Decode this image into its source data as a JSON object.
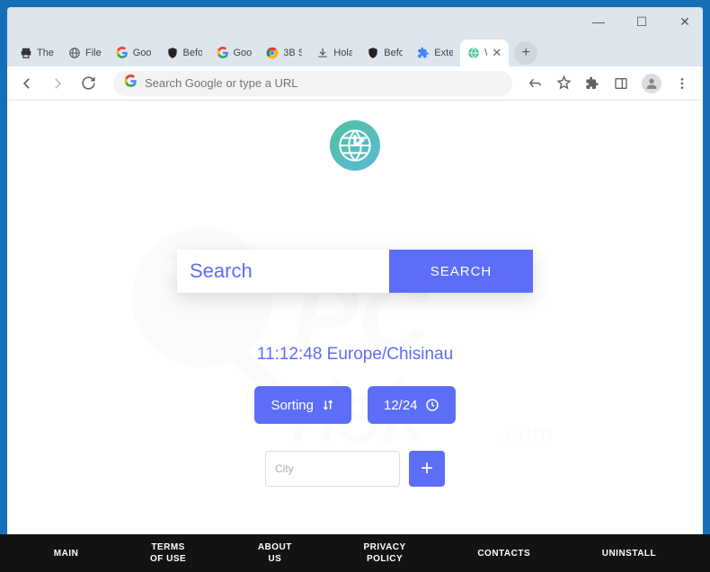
{
  "window": {
    "minimize": "—",
    "maximize": "☐",
    "close": "✕"
  },
  "tabs": [
    {
      "label": "The",
      "icon": "print"
    },
    {
      "label": "File",
      "icon": "globe-gray"
    },
    {
      "label": "Goo",
      "icon": "google"
    },
    {
      "label": "Befo",
      "icon": "shield"
    },
    {
      "label": "Goo",
      "icon": "google"
    },
    {
      "label": "3B S",
      "icon": "chrome"
    },
    {
      "label": "Hola",
      "icon": "download"
    },
    {
      "label": "Befo",
      "icon": "shield"
    },
    {
      "label": "Exte",
      "icon": "puzzle"
    },
    {
      "label": "\\",
      "icon": "globe-green",
      "active": true
    }
  ],
  "new_tab": "+",
  "omnibox": {
    "placeholder": "Search Google or type a URL"
  },
  "page": {
    "search_placeholder": "Search",
    "search_button": "SEARCH",
    "clock": "11:12:48 Europe/Chisinau",
    "sorting_label": "Sorting",
    "format_label": "12/24",
    "city_placeholder": "City",
    "add_label": "+"
  },
  "footer": {
    "main": "MAIN",
    "terms": "TERMS\nOF USE",
    "about": "ABOUT\nUS",
    "privacy": "PRIVACY\nPOLICY",
    "contacts": "CONTACTS",
    "uninstall": "UNINSTALL"
  }
}
